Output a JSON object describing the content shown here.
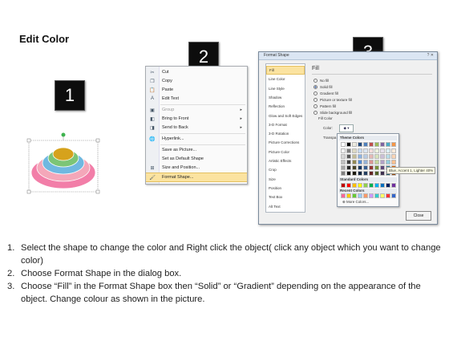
{
  "title": "Edit Color",
  "steps_markers": [
    "1",
    "2",
    "3"
  ],
  "context_menu": {
    "items": [
      {
        "icon": "cut-icon",
        "glyph": "✂",
        "label": "Cut",
        "submenu": false,
        "disabled": false
      },
      {
        "icon": "copy-icon",
        "glyph": "❐",
        "label": "Copy",
        "submenu": false,
        "disabled": false
      },
      {
        "icon": "paste-icon",
        "glyph": "📋",
        "label": "Paste",
        "submenu": false,
        "disabled": false
      },
      {
        "icon": "edit-text-icon",
        "glyph": "A",
        "label": "Edit Text",
        "submenu": false,
        "disabled": false
      },
      {
        "icon": "group-icon",
        "glyph": "▣",
        "label": "Group",
        "submenu": true,
        "disabled": true
      },
      {
        "icon": "bring-front-icon",
        "glyph": "◧",
        "label": "Bring to Front",
        "submenu": true,
        "disabled": false
      },
      {
        "icon": "send-back-icon",
        "glyph": "◨",
        "label": "Send to Back",
        "submenu": true,
        "disabled": false
      },
      {
        "icon": "hyperlink-icon",
        "glyph": "🌐",
        "label": "Hyperlink...",
        "submenu": false,
        "disabled": false
      },
      {
        "icon": "",
        "glyph": "",
        "label": "Save as Picture...",
        "submenu": false,
        "disabled": false
      },
      {
        "icon": "",
        "glyph": "",
        "label": "Set as Default Shape",
        "submenu": false,
        "disabled": false
      },
      {
        "icon": "size-position-icon",
        "glyph": "⊞",
        "label": "Size and Position...",
        "submenu": false,
        "disabled": false
      },
      {
        "icon": "format-shape-icon",
        "glyph": "🖌",
        "label": "Format Shape...",
        "submenu": false,
        "disabled": false,
        "highlighted": true
      }
    ]
  },
  "dialog": {
    "title": "Format Shape",
    "title_buttons": "? ✕",
    "nav": [
      "Fill",
      "Line Color",
      "Line Style",
      "Shadow",
      "Reflection",
      "Glow and Soft Edges",
      "3-D Format",
      "3-D Rotation",
      "Picture Corrections",
      "Picture Color",
      "Artistic Effects",
      "Crop",
      "Size",
      "Position",
      "Text Box",
      "Alt Text"
    ],
    "selected_nav": "Fill",
    "pane_heading": "Fill",
    "options": [
      {
        "label": "No fill",
        "checked": false
      },
      {
        "label": "Solid fill",
        "checked": true
      },
      {
        "label": "Gradient fill",
        "checked": false
      },
      {
        "label": "Picture or texture fill",
        "checked": false
      },
      {
        "label": "Pattern fill",
        "checked": false
      },
      {
        "label": "Slide background fill",
        "checked": false
      }
    ],
    "fill_color_heading": "Fill Color",
    "color_label": "Color:",
    "transparency_label": "Transpa",
    "color_button_glyph": "◆ ▾",
    "close_label": "Close"
  },
  "color_popup": {
    "theme_heading": "Theme Colors",
    "theme_top": [
      "#ffffff",
      "#000000",
      "#eeece1",
      "#1f497d",
      "#4f81bd",
      "#c0504d",
      "#9bbb59",
      "#8064a2",
      "#4bacc6",
      "#f79646"
    ],
    "theme_shades": [
      [
        "#f2f2f2",
        "#7f7f7f",
        "#ddd9c3",
        "#c6d9f0",
        "#dbe5f1",
        "#f2dcdb",
        "#ebf1dd",
        "#e5e0ec",
        "#dbeef3",
        "#fdeada"
      ],
      [
        "#d8d8d8",
        "#595959",
        "#c4bd97",
        "#8db3e2",
        "#b8cce4",
        "#e5b9b7",
        "#d7e3bc",
        "#ccc1d9",
        "#b7dde8",
        "#fbd5b5"
      ],
      [
        "#bfbfbf",
        "#3f3f3f",
        "#938953",
        "#548dd4",
        "#95b3d7",
        "#d99694",
        "#c3d69b",
        "#b2a2c7",
        "#92cddc",
        "#fac08f"
      ],
      [
        "#a5a5a5",
        "#262626",
        "#494429",
        "#17365d",
        "#366092",
        "#953734",
        "#76923c",
        "#5f497a",
        "#31859b",
        "#e36c09"
      ],
      [
        "#7f7f7f",
        "#0c0c0c",
        "#1d1b10",
        "#0f243e",
        "#244061",
        "#632423",
        "#4f6128",
        "#3f3151",
        "#205867",
        "#974806"
      ]
    ],
    "standard_heading": "Standard Colors",
    "standard": [
      "#c00000",
      "#ff0000",
      "#ffc000",
      "#ffff00",
      "#92d050",
      "#00b050",
      "#00b0f0",
      "#0070c0",
      "#002060",
      "#7030a0"
    ],
    "recent_heading": "Recent Colors",
    "recent": [
      "#ff6699",
      "#ffcc00",
      "#66cc33",
      "#99ccff",
      "#ff9966",
      "#cc99ff",
      "#33cccc",
      "#ffff66",
      "#ff3333",
      "#3366cc"
    ],
    "more_label": "More Colors...",
    "tooltip": "Blue, Accent 1, Lighter 40%"
  },
  "shape_colors": {
    "pink": "#f27ea8",
    "rose": "#f4a7b9",
    "blue": "#6fb8e0",
    "green": "#7cc576",
    "gold": "#d6a21c",
    "handle": "#3fb34f"
  },
  "instructions": [
    {
      "num": "1.",
      "text": "Select the shape to change the color and Right click the object( click any object which you want to change color)"
    },
    {
      "num": "2.",
      "text": "Choose Format Shape in the dialog box."
    },
    {
      "num": "3.",
      "text": "Choose “Fill” in the Format Shape box then “Solid” or “Gradient” depending on the appearance of the object. Change colour as shown in the picture."
    }
  ]
}
